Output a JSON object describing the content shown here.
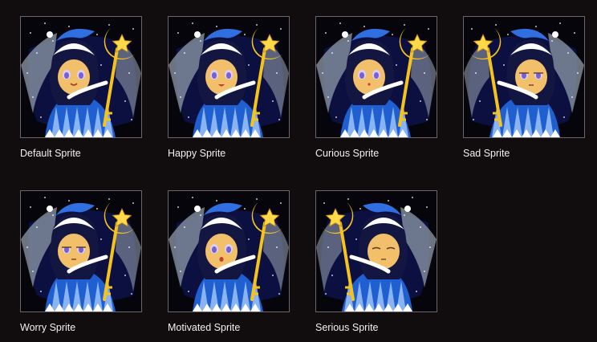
{
  "gallery": {
    "items": [
      {
        "label": "Default Sprite",
        "mirrored": false,
        "eyes": "open",
        "mouth": "smile"
      },
      {
        "label": "Happy Sprite",
        "mirrored": false,
        "eyes": "open",
        "mouth": "open"
      },
      {
        "label": "Curious Sprite",
        "mirrored": false,
        "eyes": "open",
        "mouth": "small"
      },
      {
        "label": "Sad Sprite",
        "mirrored": true,
        "eyes": "half",
        "mouth": "flat"
      },
      {
        "label": "Worry Sprite",
        "mirrored": false,
        "eyes": "half",
        "mouth": "flat"
      },
      {
        "label": "Motivated Sprite",
        "mirrored": false,
        "eyes": "open",
        "mouth": "o"
      },
      {
        "label": "Serious Sprite",
        "mirrored": true,
        "eyes": "closed",
        "mouth": "flat"
      }
    ]
  },
  "colors": {
    "page_background": "#110c0d",
    "thumb_border": "#6d6668",
    "caption_text": "#f1f1f1",
    "night_sky": "#0b1040",
    "dress_blue": "#1f5fd0",
    "dress_light": "#b8d8ff",
    "gold": "#f6c21c",
    "skin": "#f2c06a",
    "hair": "#141642"
  }
}
